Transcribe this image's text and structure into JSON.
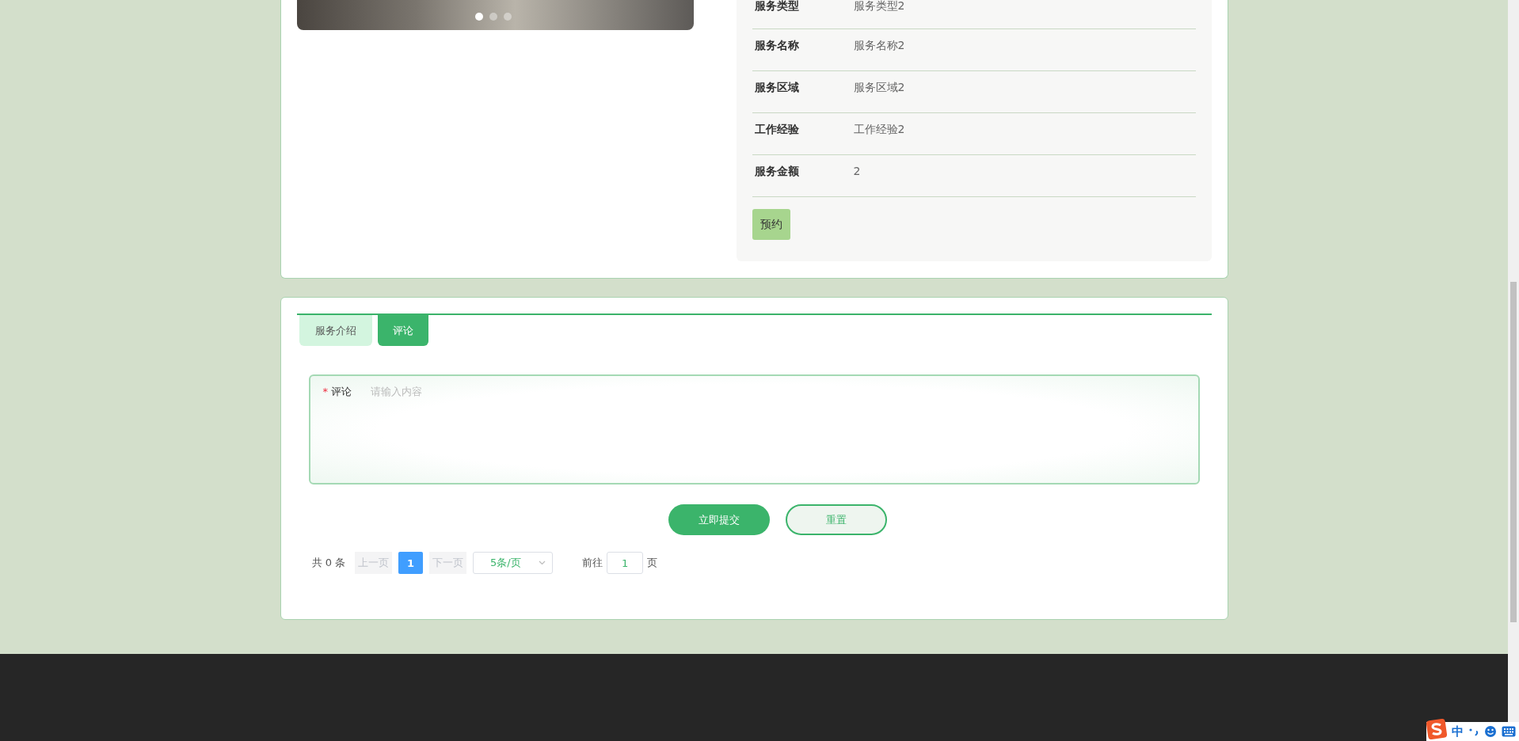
{
  "carousel": {
    "dots": [
      {
        "selected": true
      },
      {
        "selected": false
      },
      {
        "selected": false
      }
    ]
  },
  "details": {
    "rows": [
      {
        "label": "服务类型",
        "value": "服务类型2"
      },
      {
        "label": "服务名称",
        "value": "服务名称2"
      },
      {
        "label": "服务区域",
        "value": "服务区域2"
      },
      {
        "label": "工作经验",
        "value": "工作经验2"
      },
      {
        "label": "服务金额",
        "value": "2"
      }
    ],
    "button": "预约"
  },
  "tabs": [
    {
      "label": "服务介绍",
      "selected": false
    },
    {
      "label": "评论",
      "selected": true
    }
  ],
  "comment_form": {
    "label": "评论",
    "required_mark": "*",
    "placeholder": "请输入内容",
    "submit": "立即提交",
    "reset": "重置"
  },
  "pagination": {
    "total": "共 0 条",
    "prev": {
      "label": "上一页",
      "disabled": true
    },
    "pages": [
      {
        "label": "1",
        "selected": true
      }
    ],
    "next": {
      "label": "下一页",
      "disabled": true
    },
    "page_size": "5条/页",
    "jump_label": "前往",
    "jump_value": "1",
    "jump_suffix": "页"
  },
  "ime_bar": {
    "mode": "中"
  }
}
